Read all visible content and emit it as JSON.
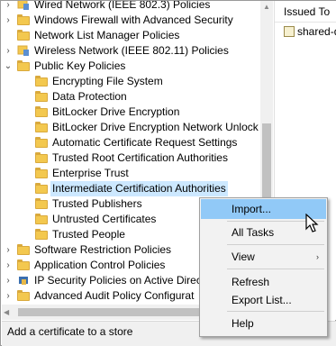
{
  "tree": {
    "items": [
      {
        "label": "Wired Network (IEEE 802.3) Policies",
        "expander": "›",
        "icon": "network-policy-icon"
      },
      {
        "label": "Windows Firewall with Advanced Security",
        "expander": "›",
        "icon": "folder-icon"
      },
      {
        "label": "Network List Manager Policies",
        "expander": "",
        "icon": "folder-icon"
      },
      {
        "label": "Wireless Network (IEEE 802.11) Policies",
        "expander": "›",
        "icon": "network-policy-icon"
      },
      {
        "label": "Public Key Policies",
        "expander": "⌄",
        "icon": "folder-icon"
      },
      {
        "label": "Encrypting File System",
        "expander": "",
        "icon": "folder-icon"
      },
      {
        "label": "Data Protection",
        "expander": "",
        "icon": "folder-icon"
      },
      {
        "label": "BitLocker Drive Encryption",
        "expander": "",
        "icon": "folder-icon"
      },
      {
        "label": "BitLocker Drive Encryption Network Unlock C",
        "expander": "",
        "icon": "folder-icon"
      },
      {
        "label": "Automatic Certificate Request Settings",
        "expander": "",
        "icon": "folder-icon"
      },
      {
        "label": "Trusted Root Certification Authorities",
        "expander": "",
        "icon": "folder-icon"
      },
      {
        "label": "Enterprise Trust",
        "expander": "",
        "icon": "folder-icon"
      },
      {
        "label": "Intermediate Certification Authorities",
        "expander": "",
        "icon": "folder-icon",
        "selected": true
      },
      {
        "label": "Trusted Publishers",
        "expander": "",
        "icon": "folder-icon"
      },
      {
        "label": "Untrusted Certificates",
        "expander": "",
        "icon": "folder-icon"
      },
      {
        "label": "Trusted People",
        "expander": "",
        "icon": "folder-icon"
      },
      {
        "label": "Software Restriction Policies",
        "expander": "›",
        "icon": "folder-icon"
      },
      {
        "label": "Application Control Policies",
        "expander": "›",
        "icon": "folder-icon"
      },
      {
        "label": "IP Security Policies on Active Direc",
        "expander": "›",
        "icon": "ip-security-icon"
      },
      {
        "label": "Advanced Audit Policy Configurat",
        "expander": "›",
        "icon": "folder-icon"
      }
    ]
  },
  "right_pane": {
    "column_header": "Issued To",
    "item": "shared-d"
  },
  "status_bar": {
    "text": "Add a certificate to a store"
  },
  "context_menu": {
    "items": [
      {
        "label": "Import...",
        "hover": true
      },
      {
        "label": "All Tasks"
      },
      {
        "label": "View",
        "submenu": true
      },
      {
        "label": "Refresh"
      },
      {
        "label": "Export List..."
      },
      {
        "label": "Help"
      }
    ],
    "submenu_glyph": "›"
  },
  "colors": {
    "selection": "#cce8ff",
    "menu_hover": "#91c9f7",
    "folder": "#f3c84f"
  }
}
